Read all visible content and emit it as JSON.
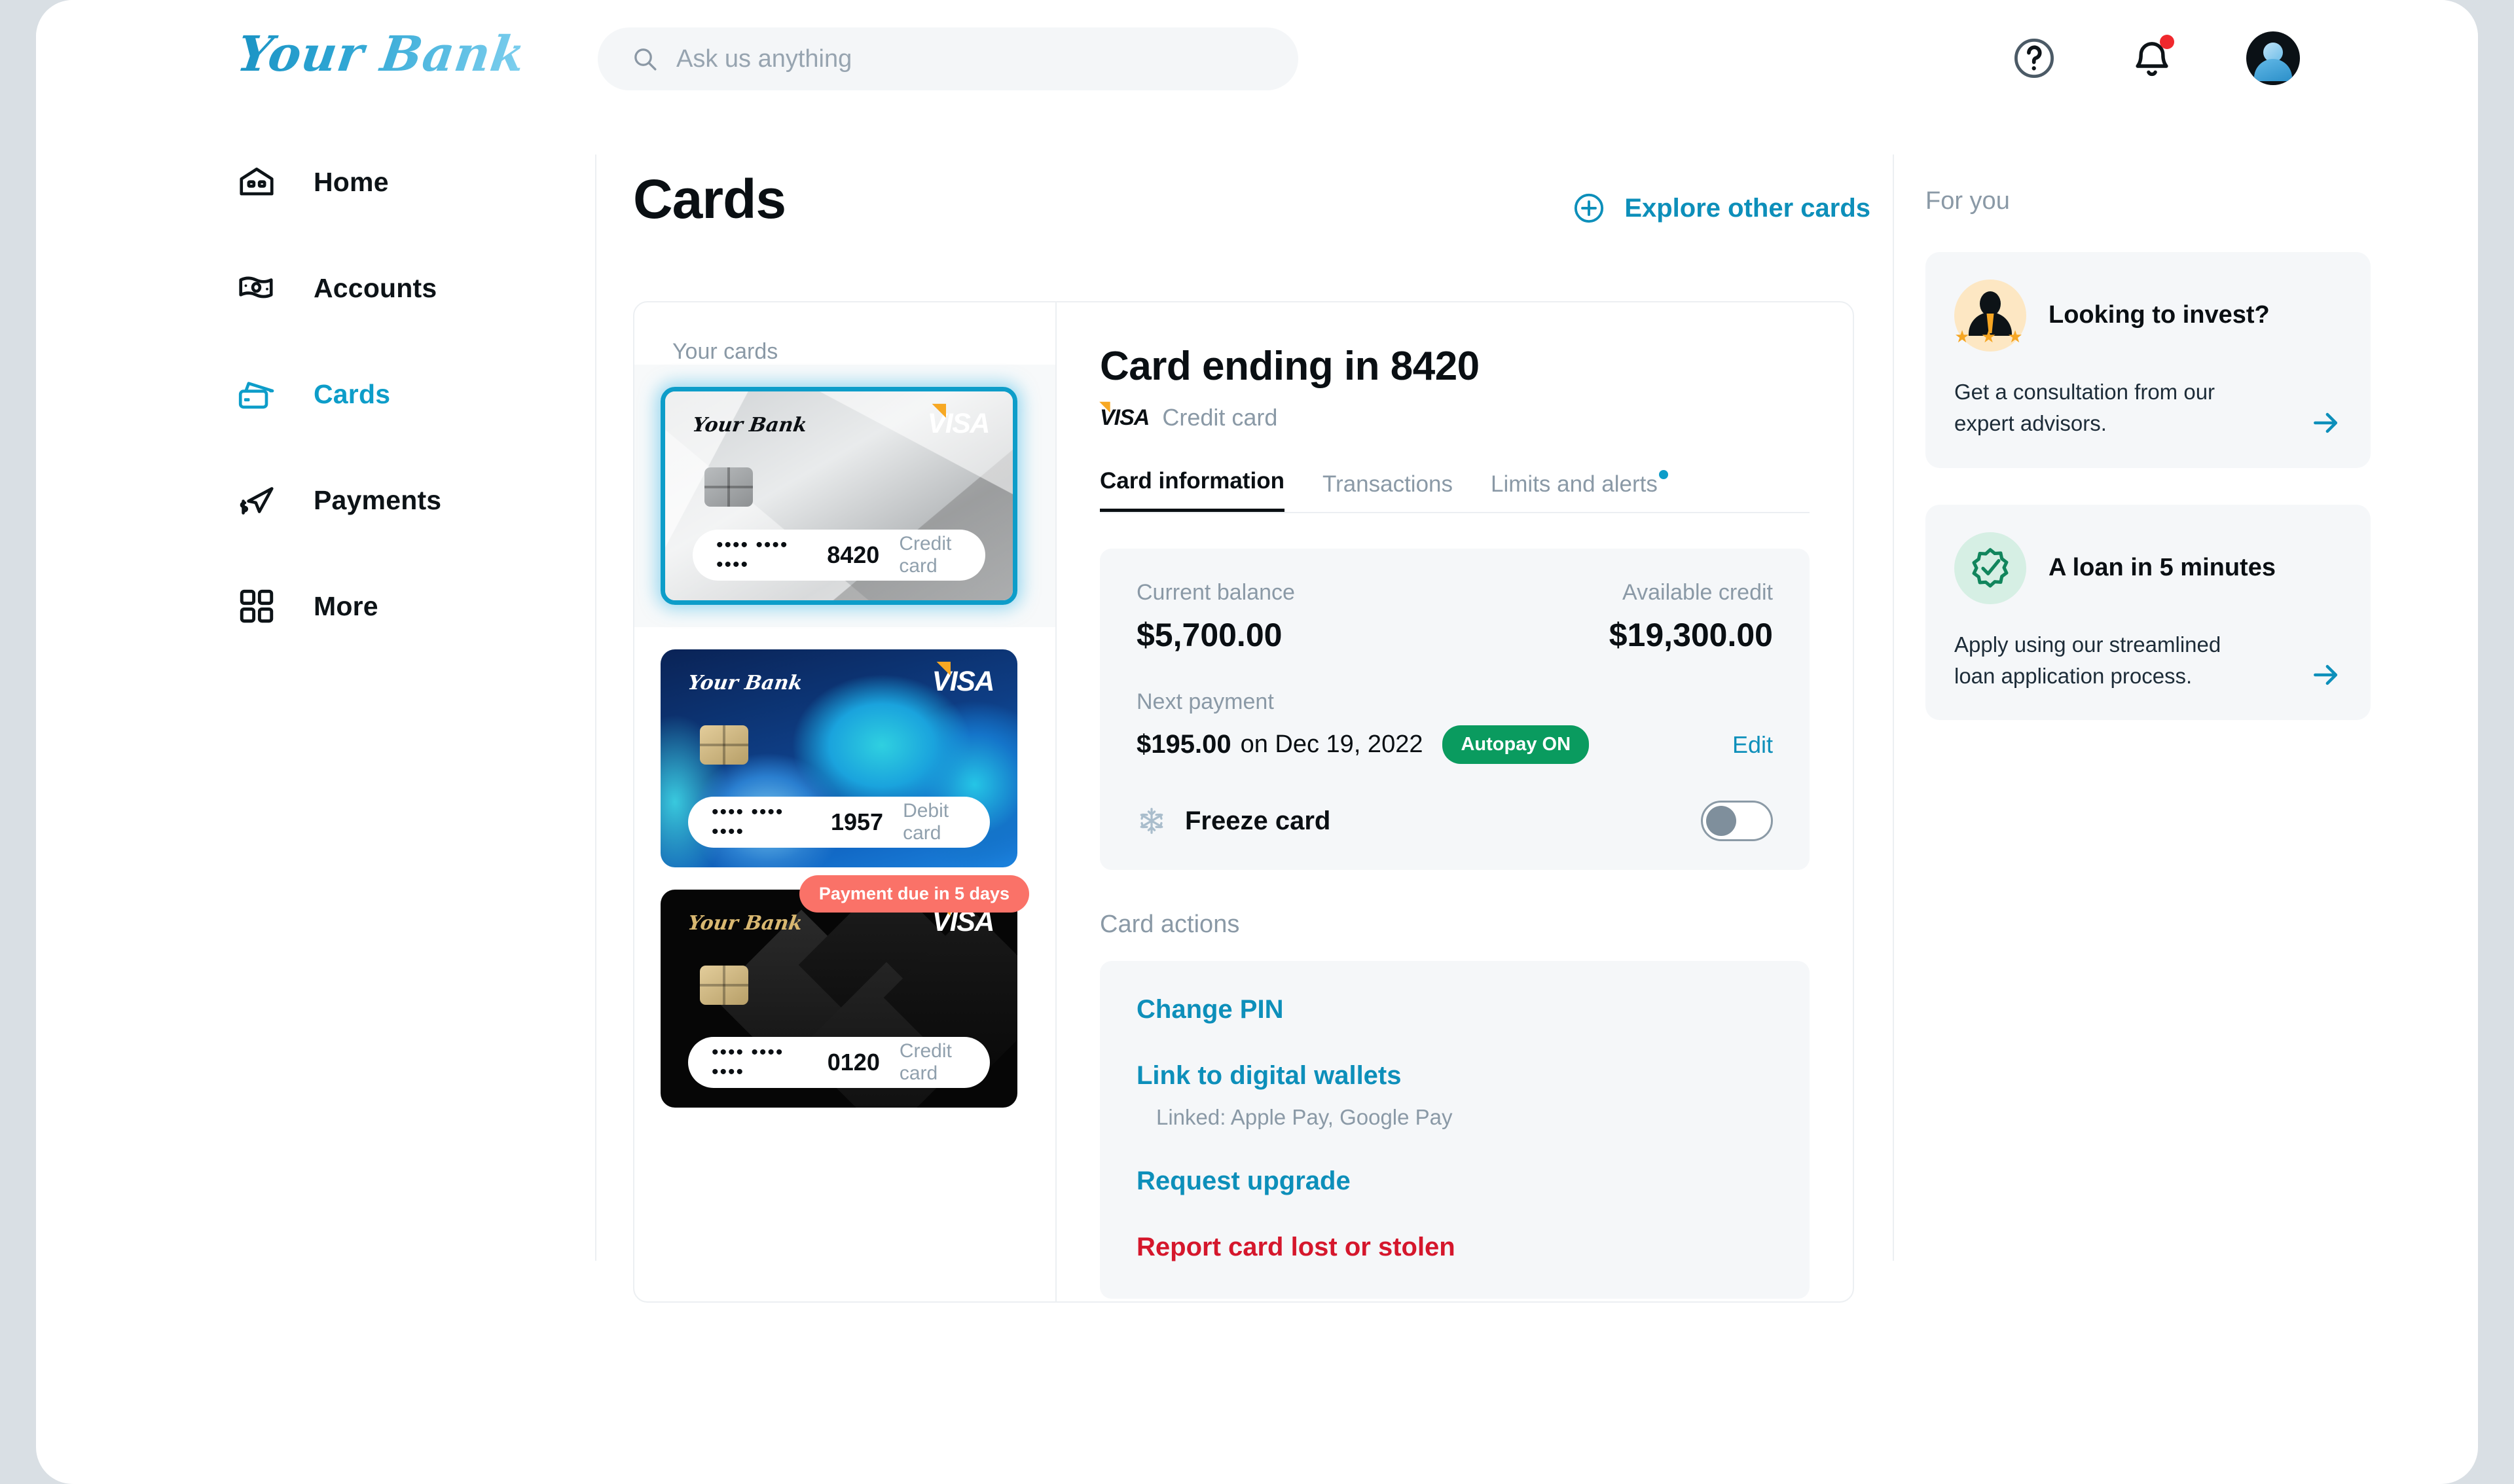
{
  "brand": {
    "name": "Your Bank"
  },
  "search": {
    "value": "",
    "placeholder": "Ask us anything"
  },
  "topbar": {
    "help_label": "Help",
    "notifications_label": "Notifications",
    "avatar_label": "Account"
  },
  "sidebar": {
    "items": [
      {
        "label": "Home",
        "icon": "home-icon",
        "active": false
      },
      {
        "label": "Accounts",
        "icon": "banknote-icon",
        "active": false
      },
      {
        "label": "Cards",
        "icon": "cards-icon",
        "active": true
      },
      {
        "label": "Payments",
        "icon": "send-money-icon",
        "active": false
      },
      {
        "label": "More",
        "icon": "grid-icon",
        "active": false
      }
    ]
  },
  "main": {
    "title": "Cards",
    "explore_label": "Explore other cards",
    "cardlist_title": "Your cards",
    "cards": [
      {
        "masked": "•••• •••• ••••",
        "last4": "8420",
        "type": "Credit card",
        "brand": "Your Bank",
        "network": "VISA",
        "style": "silver",
        "selected": true,
        "badge": ""
      },
      {
        "masked": "•••• •••• ••••",
        "last4": "1957",
        "type": "Debit card",
        "brand": "Your Bank",
        "network": "VISA",
        "style": "blue",
        "selected": false,
        "badge": ""
      },
      {
        "masked": "•••• •••• ••••",
        "last4": "0120",
        "type": "Credit card",
        "brand": "Your Bank",
        "network": "VISA",
        "style": "black",
        "selected": false,
        "badge": "Payment due in 5 days"
      }
    ],
    "detail": {
      "heading": "Card ending in 8420",
      "network": "VISA",
      "card_type": "Credit card",
      "tabs": [
        {
          "label": "Card information",
          "active": true,
          "dot": false
        },
        {
          "label": "Transactions",
          "active": false,
          "dot": false
        },
        {
          "label": "Limits and alerts",
          "active": false,
          "dot": true
        }
      ],
      "balance": {
        "current_label": "Current balance",
        "current_value": "$5,700.00",
        "available_label": "Available credit",
        "available_value": "$19,300.00",
        "next_label": "Next payment",
        "next_amount": "$195.00",
        "next_date": "on Dec 19, 2022",
        "autopay_badge": "Autopay ON",
        "edit_label": "Edit"
      },
      "freeze": {
        "label": "Freeze card",
        "state": "off"
      },
      "actions_title": "Card actions",
      "actions": [
        {
          "label": "Change PIN",
          "sub": "",
          "danger": false
        },
        {
          "label": "Link to digital wallets",
          "sub": "Linked: Apple Pay, Google Pay",
          "danger": false
        },
        {
          "label": "Request upgrade",
          "sub": "",
          "danger": false
        },
        {
          "label": "Report card lost or stolen",
          "sub": "",
          "danger": true
        }
      ]
    }
  },
  "rail": {
    "title": "For you",
    "promos": [
      {
        "title": "Looking to invest?",
        "text": "Get a consultation from our expert advisors.",
        "icon": "advisor-icon",
        "stars": "★ ★ ★"
      },
      {
        "title": "A loan in 5 minutes",
        "text": "Apply using our streamlined loan application process.",
        "icon": "verified-badge-icon",
        "stars": ""
      }
    ]
  },
  "colors": {
    "accent": "#0d9dc9",
    "link": "#0d8fba",
    "danger": "#d5172c",
    "success": "#0a9b5f",
    "warning": "#fa7268",
    "muted": "#8a99a6"
  }
}
